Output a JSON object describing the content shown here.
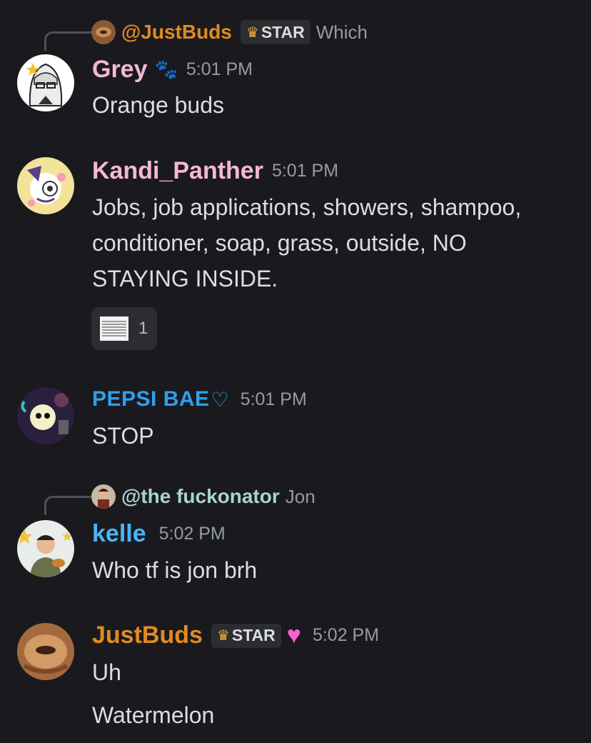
{
  "colors": {
    "background": "#1a1a1e",
    "grey": "#f2b8d8",
    "kandi": "#f5b8d6",
    "pepsi": "#2fa0ea",
    "fuckonator": "#a8d5c8",
    "kelle": "#49b5f7",
    "justbuds": "#e08a24",
    "muted": "#949ba4"
  },
  "messages": [
    {
      "reply": {
        "name": "@JustBuds",
        "tag": "STAR",
        "text": "Which"
      },
      "user": "Grey",
      "icon": "paw-prints-icon",
      "time": "5:01 PM",
      "lines": [
        "Orange buds"
      ]
    },
    {
      "user": "Kandi_Panther",
      "time": "5:01 PM",
      "text": "Jobs, job applications, showers, shampoo, conditioner, soap, grass, outside, NO STAYING INSIDE.",
      "attachment_count": "1"
    },
    {
      "user": "PEPSI BAE",
      "icon": "cyan-heart-icon",
      "time": "5:01 PM",
      "lines": [
        "STOP"
      ]
    },
    {
      "reply": {
        "name": "@the fuckonator",
        "text": "Jon"
      },
      "user": "kelle",
      "time": "5:02 PM",
      "lines": [
        "Who tf is jon brh"
      ]
    },
    {
      "user": "JustBuds",
      "tag": "STAR",
      "icon": "pink-heart-icon",
      "time": "5:02 PM",
      "lines": [
        "Uh",
        "Watermelon"
      ]
    }
  ]
}
